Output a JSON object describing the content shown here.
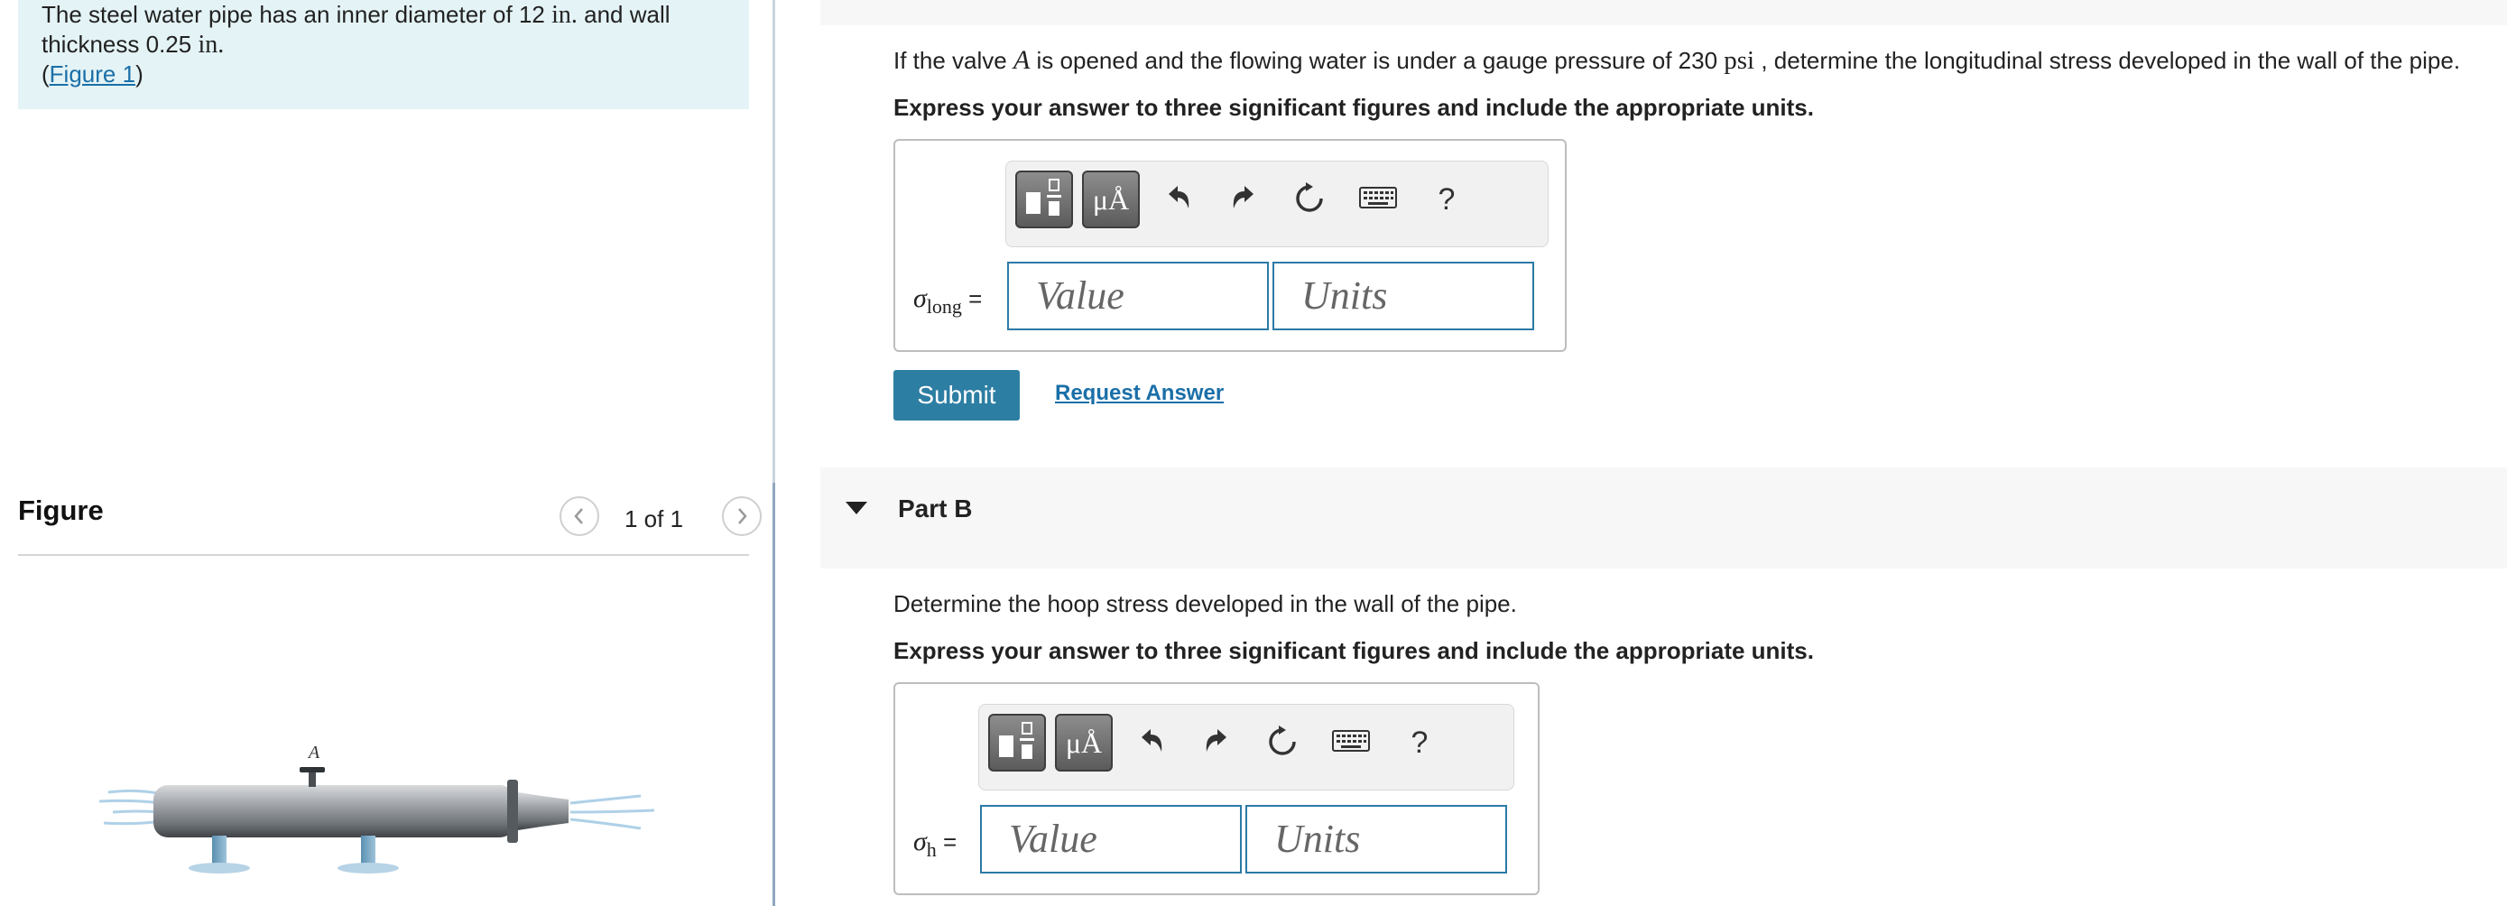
{
  "problem": {
    "line1_pre": "The steel water pipe has an inner diameter of 12 ",
    "line1_unit": "in.",
    "line1_post": " and wall",
    "line2_pre": "thickness 0.25 ",
    "line2_unit": "in.",
    "paren_open": "(",
    "figure_link": "Figure 1",
    "paren_close": ")"
  },
  "figure": {
    "title": "Figure",
    "count": "1 of 1",
    "prev_icon": "chevron-left-icon",
    "next_icon": "chevron-right-icon",
    "valve_label": "A"
  },
  "partA": {
    "question_pre": "If the valve ",
    "question_var": "A",
    "question_mid": " is opened and the flowing water is under a gauge pressure of 230 ",
    "question_unit": "psi",
    "question_post": " , determine the longitudinal stress developed in the wall of the pipe.",
    "instruction": "Express your answer to three significant figures and include the appropriate units.",
    "var_symbol": "σ",
    "var_sub": "long",
    "equals": " =",
    "value_placeholder": "Value",
    "units_placeholder": "Units",
    "submit_label": "Submit",
    "request_label": "Request Answer"
  },
  "partB": {
    "title": "Part B",
    "question": "Determine the hoop stress developed in the wall of the pipe.",
    "instruction": "Express your answer to three significant figures and include the appropriate units.",
    "var_symbol": "σ",
    "var_sub": "h",
    "equals": " =",
    "value_placeholder": "Value",
    "units_placeholder": "Units"
  },
  "toolbar": {
    "units_btn": "μÅ",
    "help": "?"
  },
  "colors": {
    "accent": "#2d7ea3",
    "link": "#1a6fa8",
    "problem_bg": "#e4f3f5"
  }
}
